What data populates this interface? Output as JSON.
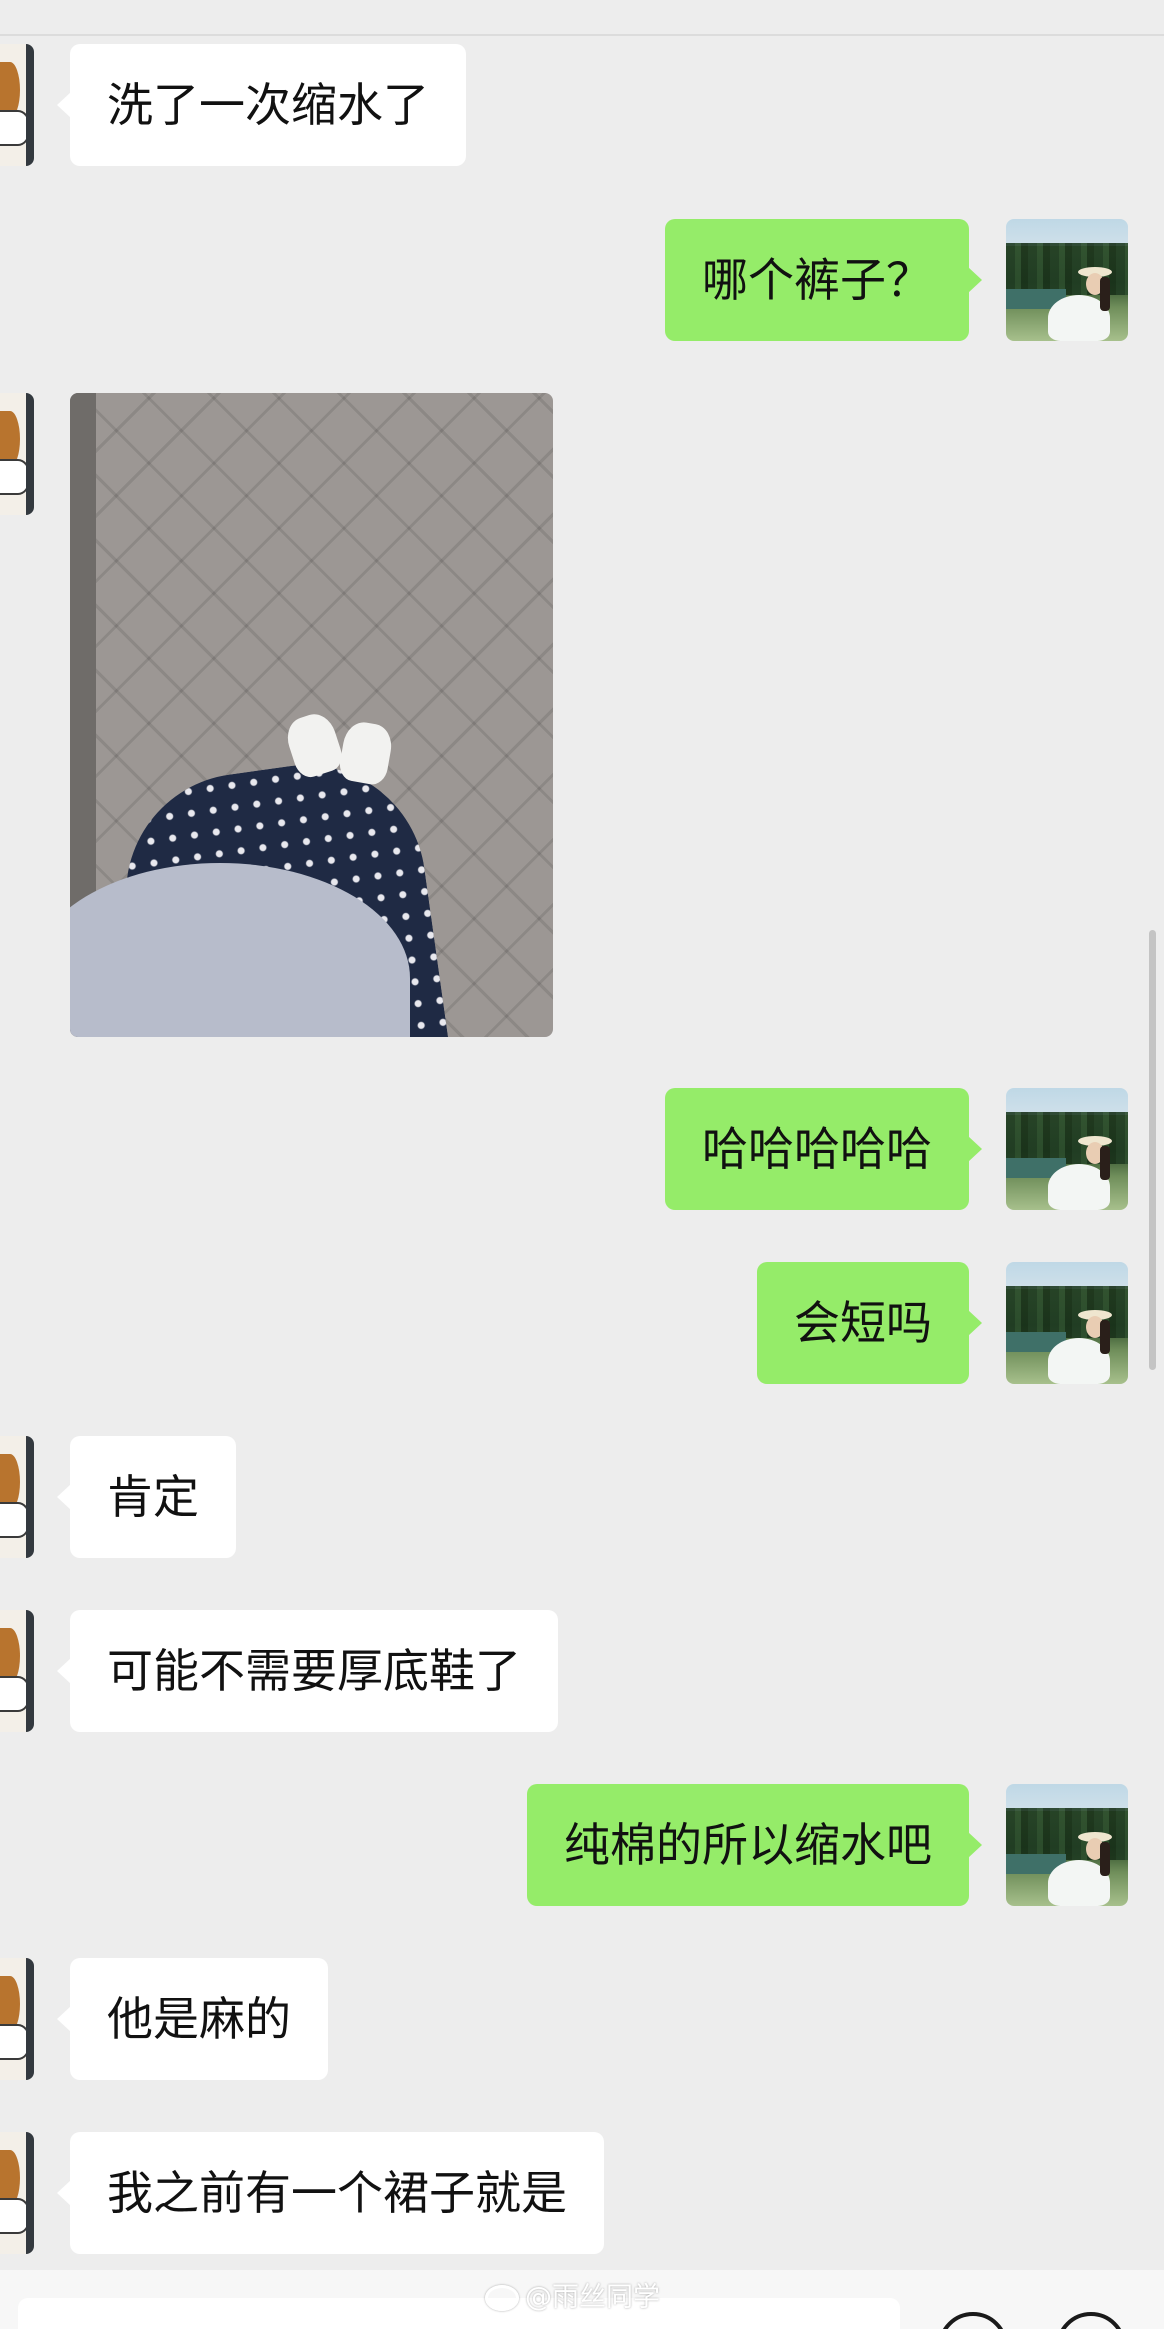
{
  "messages": [
    {
      "side": "left",
      "text": "洗了一次缩水了"
    },
    {
      "side": "right",
      "text": "哪个裤子？"
    },
    {
      "side": "left",
      "type": "image",
      "image_desc": "photo"
    },
    {
      "side": "right",
      "text": "哈哈哈哈哈"
    },
    {
      "side": "right",
      "text": "会短吗"
    },
    {
      "side": "left",
      "text": "肯定"
    },
    {
      "side": "left",
      "text": "可能不需要厚底鞋了"
    },
    {
      "side": "right",
      "text": "纯棉的所以缩水吧"
    },
    {
      "side": "left",
      "text": "他是麻的"
    },
    {
      "side": "left",
      "text": "我之前有一个裙子就是"
    }
  ],
  "watermark": "@雨丝同学",
  "colors": {
    "background": "#ededed",
    "incoming_bubble": "#ffffff",
    "outgoing_bubble": "#95ec69"
  }
}
